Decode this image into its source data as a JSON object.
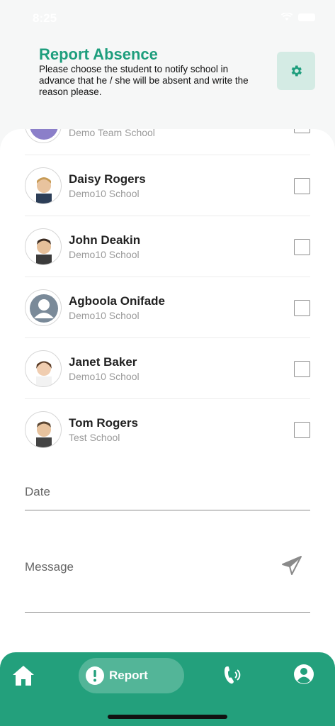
{
  "status_bar": {
    "time": "8:25"
  },
  "header": {
    "title": "Report Absence",
    "subtitle": "Please choose the student to notify school in advance that he / she will be absent and write the reason please."
  },
  "students": [
    {
      "name": "",
      "school": "Demo Team School"
    },
    {
      "name": "Daisy Rogers",
      "school": "Demo10 School"
    },
    {
      "name": "John Deakin",
      "school": "Demo10 School"
    },
    {
      "name": "Agboola Onifade",
      "school": "Demo10 School"
    },
    {
      "name": "Janet Baker",
      "school": "Demo10 School"
    },
    {
      "name": "Tom Rogers",
      "school": "Test School"
    }
  ],
  "form": {
    "date_placeholder": "Date",
    "message_placeholder": "Message"
  },
  "tabbar": {
    "report_label": "Report",
    "active_tab": "report"
  },
  "colors": {
    "accent": "#1e9e7d",
    "tabbar": "#23a07c",
    "settings_bg": "#d4ebe4"
  },
  "icons": {
    "settings": "gear-icon",
    "send": "send-icon",
    "home": "home-icon",
    "report": "alert-icon",
    "phone": "phone-icon",
    "profile": "profile-icon"
  }
}
